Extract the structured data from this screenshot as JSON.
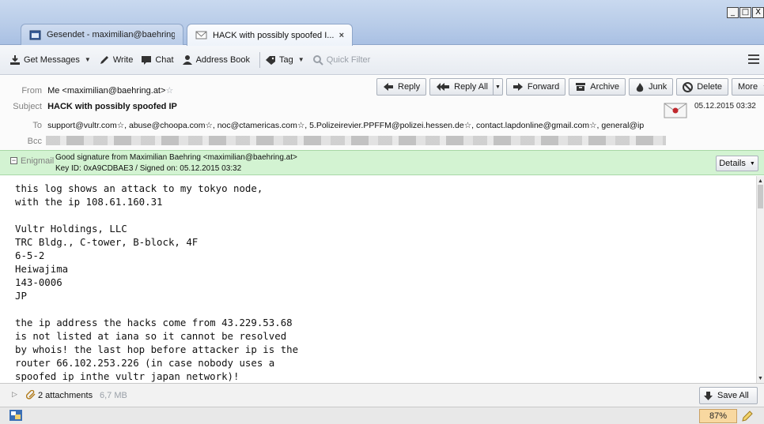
{
  "window": {
    "controls": [
      "_",
      "□",
      "X"
    ]
  },
  "tabs": [
    {
      "title": "Gesendet - maximilian@baehring...",
      "active": false,
      "icon": "calendar-icon"
    },
    {
      "title": "HACK with possibly spoofed I...",
      "active": true,
      "icon": "envelope-icon",
      "close": "×"
    }
  ],
  "toolbar": {
    "get_messages": "Get Messages",
    "write": "Write",
    "chat": "Chat",
    "address_book": "Address Book",
    "tag": "Tag",
    "quick_filter": "Quick Filter"
  },
  "header": {
    "from_label": "From",
    "from_value": "Me <maximilian@baehring.at>",
    "subject_label": "Subject",
    "subject_value": "HACK with possibly spoofed IP",
    "to_label": "To",
    "to_value": "support@vultr.com☆, abuse@choopa.com☆, noc@ctamericas.com☆, 5.Polizeirevier.PPFFM@polizei.hessen.de☆, contact.lapdonline@gmail.com☆, general@ip",
    "bcc_label": "Bcc",
    "date": "05.12.2015 03:32",
    "buttons": {
      "reply": "Reply",
      "reply_all": "Reply All",
      "forward": "Forward",
      "archive": "Archive",
      "junk": "Junk",
      "delete": "Delete",
      "more": "More"
    }
  },
  "enigmail": {
    "label": "Enigmail",
    "line1": "Good signature from Maximilian Baehring <maximilian@baehring.at>",
    "line2": "Key ID: 0xA9CDBAE3 / Signed on: 05.12.2015 03:32",
    "details": "Details"
  },
  "body": {
    "text": "this log shows an attack to my tokyo node,\nwith the ip 108.61.160.31\n\nVultr Holdings, LLC\nTRC Bldg., C-tower, B-block, 4F\n6-5-2\nHeiwajima\n143-0006\nJP\n\nthe ip address the hacks come from 43.229.53.68\nis not listed at iana so it cannot be resolved\nby whois! the last hop before attacker ip is the\nrouter 66.102.253.226 (in case nobody uses a\nspoofed ip inthe vultr japan network)!"
  },
  "attachments": {
    "count": "2 attachments",
    "size": "6,7 MB",
    "save_all": "Save All"
  },
  "status": {
    "zoom": "87%"
  },
  "colors": {
    "titlebar": "#b7cbe8",
    "enigmail_bg": "#d3f3d2",
    "zoom_bg": "#f8d8a0"
  }
}
